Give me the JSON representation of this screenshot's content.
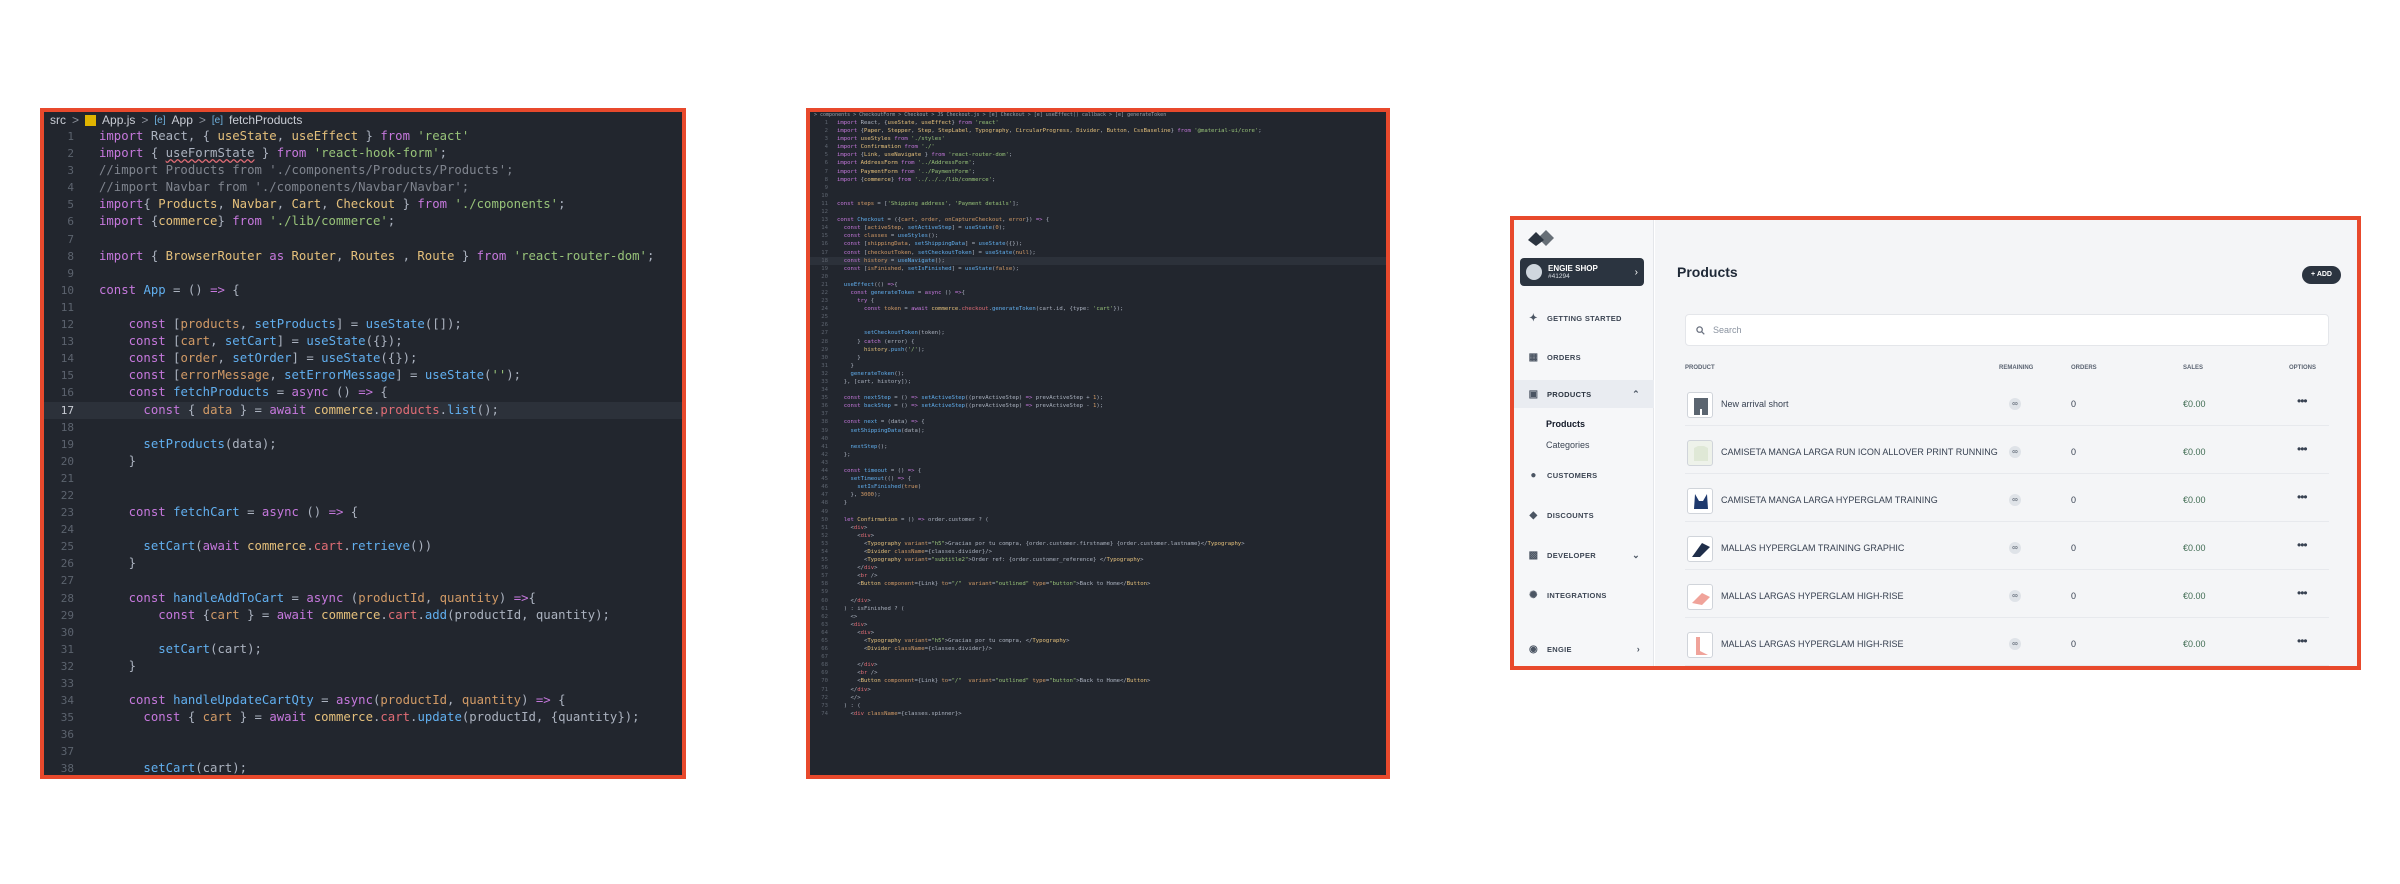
{
  "editor1": {
    "breadcrumb": [
      "src",
      "App.js",
      "App",
      "fetchProducts"
    ],
    "active_line": 17
  },
  "editor2": {
    "breadcrumb": "> components > CheckoutForm > Checkout > JS Checkout.js > [e] Checkout > [e] useEffect() callback > [e] generateToken",
    "active_line": 18
  },
  "dashboard": {
    "shop_name": "ENGIE SHOP",
    "shop_id": "#41294",
    "nav": {
      "getting_started": "GETTING STARTED",
      "orders": "ORDERS",
      "products": "PRODUCTS",
      "sub_products": "Products",
      "sub_categories": "Categories",
      "customers": "CUSTOMERS",
      "discounts": "DISCOUNTS",
      "developer": "DEVELOPER",
      "integrations": "INTEGRATIONS",
      "user": "ENGIE"
    },
    "page_title": "Products",
    "add_label": "+ ADD",
    "search_placeholder": "Search",
    "columns": {
      "product": "PRODUCT",
      "remaining": "REMAINING",
      "orders": "ORDERS",
      "sales": "SALES",
      "options": "OPTIONS"
    },
    "products": [
      {
        "name": "New arrival short",
        "remaining": "∞",
        "orders": "0",
        "sales": "€0.00",
        "options": "•••"
      },
      {
        "name": "CAMISETA MANGA LARGA RUN ICON ALLOVER PRINT RUNNING",
        "remaining": "∞",
        "orders": "0",
        "sales": "€0.00",
        "options": "•••"
      },
      {
        "name": "CAMISETA MANGA LARGA HYPERGLAM TRAINING",
        "remaining": "∞",
        "orders": "0",
        "sales": "€0.00",
        "options": "•••"
      },
      {
        "name": "MALLAS HYPERGLAM TRAINING GRAPHIC",
        "remaining": "∞",
        "orders": "0",
        "sales": "€0.00",
        "options": "•••"
      },
      {
        "name": "MALLAS LARGAS HYPERGLAM HIGH-RISE",
        "remaining": "∞",
        "orders": "0",
        "sales": "€0.00",
        "options": "•••"
      },
      {
        "name": "MALLAS LARGAS HYPERGLAM HIGH-RISE",
        "remaining": "∞",
        "orders": "0",
        "sales": "€0.00",
        "options": "•••"
      }
    ]
  }
}
